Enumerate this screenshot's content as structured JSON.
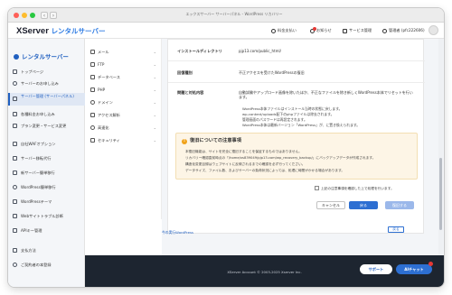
{
  "window": {
    "title": "エックスサーバー サーバーパネル - WordPress リカバリー"
  },
  "header": {
    "logo": "XServer",
    "logo_sub": "レンタルサーバー",
    "items": [
      "料金支払い",
      "お知らせ",
      "サービス管理",
      "管理者 (pfc222606)"
    ]
  },
  "sidebar": {
    "brand": "レンタルサーバー",
    "items": [
      {
        "label": "トップページ",
        "icon": "home-icon"
      },
      {
        "label": "サーバーのお申し込み",
        "icon": "plus-icon"
      },
      {
        "label": "サーバー管理 (サーバーパネル)",
        "icon": "server-icon"
      },
      {
        "label": "各種料金お申し込み",
        "icon": "yen-icon"
      },
      {
        "label": "プラン変更・サービス変更",
        "icon": "swap-icon"
      },
      {
        "label": "自社WAFオプション",
        "icon": "shield-icon"
      },
      {
        "label": "サーバー移転代行",
        "icon": "move-icon"
      },
      {
        "label": "新サーバー簡単移行",
        "icon": "transfer-icon"
      },
      {
        "label": "WordPress簡単移行",
        "icon": "wp-icon"
      },
      {
        "label": "WordPressテーマ",
        "icon": "theme-icon"
      },
      {
        "label": "Webサイトトラブル診断",
        "icon": "diagnosis-icon"
      },
      {
        "label": "APIキー管理",
        "icon": "key-icon"
      },
      {
        "label": "支払方法",
        "icon": "card-icon"
      },
      {
        "label": "ご契約者の本登録",
        "icon": "user-icon"
      }
    ]
  },
  "submenu": {
    "items": [
      "メール",
      "FTP",
      "データベース",
      "PHP",
      "ドメイン",
      "アクセス解析",
      "高速化",
      "セキュリティ"
    ]
  },
  "form": {
    "install_dir_label": "インストールディレクトリ",
    "install_dir_value": "pjp13.com/public_html/",
    "state_label": "回復種別",
    "state_value": "不正アクセスを受けたWordPressの復旧",
    "problem_label": "問題と対処内容",
    "problem_desc": "自動試験やアップロード画像を除いたほか、不正なファイルを除き新しくWordPress本体でリセットを行います。",
    "bullets": [
      "WordPress本体ファイルはインストール当時の状態に戻します。",
      "wp-content/uploads配下のphpファイルは除去されます。",
      "管理画面のパスワードは再設定されます。",
      "WordPress本体は最新バージョン「WordPress」が、に置き換えられます。"
    ]
  },
  "warning": {
    "title": "復旧についての注意事項",
    "lines": [
      "本復旧機能は、サイトを完全に復旧することを保証するものではありません。",
      "リカバリー確認直前時点の「/home/xs839049/pjp13.com/wp_recovery_backup/」にバックアップデータが作成されます。",
      "構造化変更目録はウェブサイトに反映されるまでの確認を必ず行ってください。",
      "データサイズ、ファイル数、およびサーバーの負荷状況によっては、処理に時間がかかる場合があります。"
    ]
  },
  "agree_label": "上記の注意事項を確認した上で処理を行います。",
  "buttons": {
    "cancel": "キャンセル",
    "back": "戻る",
    "install": "復旧する"
  },
  "footer_link": "今の実行WordPress",
  "back_button": "戻る",
  "footer": {
    "copyright": "XServer Account © 2003-2025 Xserver Inc.",
    "support": "サポート",
    "ai": "AIチャット"
  }
}
